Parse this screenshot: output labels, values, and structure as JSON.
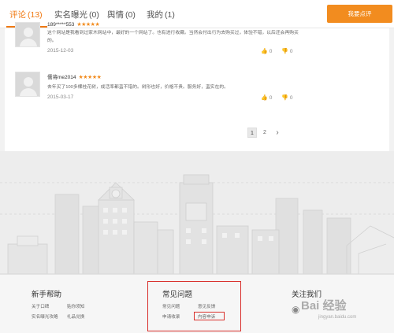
{
  "tabs": [
    {
      "label": "评论",
      "count": "(13)",
      "active": true
    },
    {
      "label": "实名曝光",
      "count": "(0)",
      "active": false
    },
    {
      "label": "舆情",
      "count": "(0)",
      "active": false
    },
    {
      "label": "我的",
      "count": "(1)",
      "active": false
    }
  ],
  "review_button_label": "我要点评",
  "reviews": [
    {
      "user": "189*****553",
      "stars": "★★★★★",
      "text": "这个网站是我看到过家木网站中，最好的一个网站了。也有进行收藏。当然会付出行为去购买过，体验不错，以后还会再购买的。",
      "date": "2015-12-03",
      "likes": "0",
      "dislikes": "0"
    },
    {
      "user": "儒将me2014",
      "stars": "★★★★★",
      "text": "去年买了100多棵桂花树，成活率都蛮不错的。树形也好，价格不贵。服务好，蛮实在的。",
      "date": "2015-03-17",
      "likes": "0",
      "dislikes": "0"
    }
  ],
  "pagination": {
    "pages": [
      "1",
      "2"
    ],
    "current": "1",
    "next_icon": "chevron-right-icon",
    "next_glyph": "›"
  },
  "footer": {
    "help": {
      "title": "新手帮助",
      "links": [
        "关于口碑",
        "贴你须知",
        "实名曝光攻略",
        "礼品兑换"
      ]
    },
    "faq": {
      "title": "常见问题",
      "links": [
        "常见问题",
        "意见反馈",
        "申请收录",
        "内容申诉"
      ]
    },
    "follow": {
      "title": "关注我们"
    },
    "watermark": "Bai 经验",
    "watermark_sub": "jingyan.baidu.com"
  },
  "colors": {
    "accent": "#f07a14",
    "button": "#f28c1f",
    "highlight_box": "#d9302c"
  }
}
